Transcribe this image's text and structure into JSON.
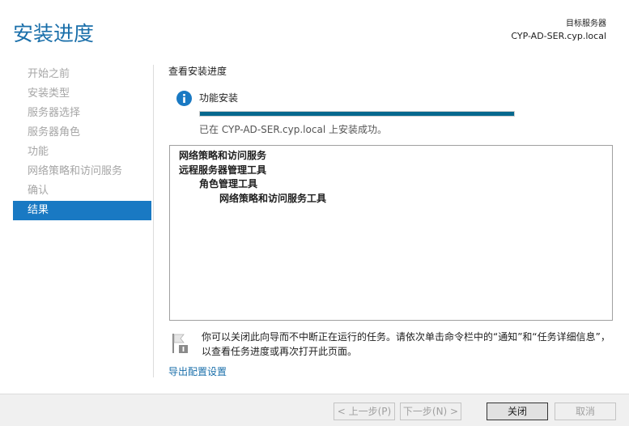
{
  "header": {
    "title": "安装进度",
    "server_label": "目标服务器",
    "server_name": "CYP-AD-SER.cyp.local"
  },
  "nav": {
    "items": [
      {
        "label": "开始之前"
      },
      {
        "label": "安装类型"
      },
      {
        "label": "服务器选择"
      },
      {
        "label": "服务器角色"
      },
      {
        "label": "功能"
      },
      {
        "label": "网络策略和访问服务"
      },
      {
        "label": "确认"
      },
      {
        "label": "结果"
      }
    ],
    "active_index": 7
  },
  "main": {
    "section_heading": "查看安装进度",
    "install_label": "功能安装",
    "progress": 1.0,
    "status_text": "已在 CYP-AD-SER.cyp.local 上安装成功。",
    "results": [
      {
        "label": "网络策略和访问服务",
        "level": 1
      },
      {
        "label": "远程服务器管理工具",
        "level": 1
      },
      {
        "label": "角色管理工具",
        "level": 2
      },
      {
        "label": "网络策略和访问服务工具",
        "level": 3
      }
    ],
    "hint_text": "你可以关闭此向导而不中断正在运行的任务。请依次单击命令栏中的“通知”和“任务详细信息”，以查看任务进度或再次打开此页面。",
    "export_link": "导出配置设置"
  },
  "footer": {
    "prev_label": "< 上一步(P)",
    "next_label": "下一步(N) >",
    "close_label": "关闭",
    "cancel_label": "取消"
  },
  "colors": {
    "accent": "#1979c3",
    "title": "#1a6faa",
    "progress": "#06688e"
  },
  "icons": {
    "info": "info-icon",
    "flag": "flag-icon"
  }
}
